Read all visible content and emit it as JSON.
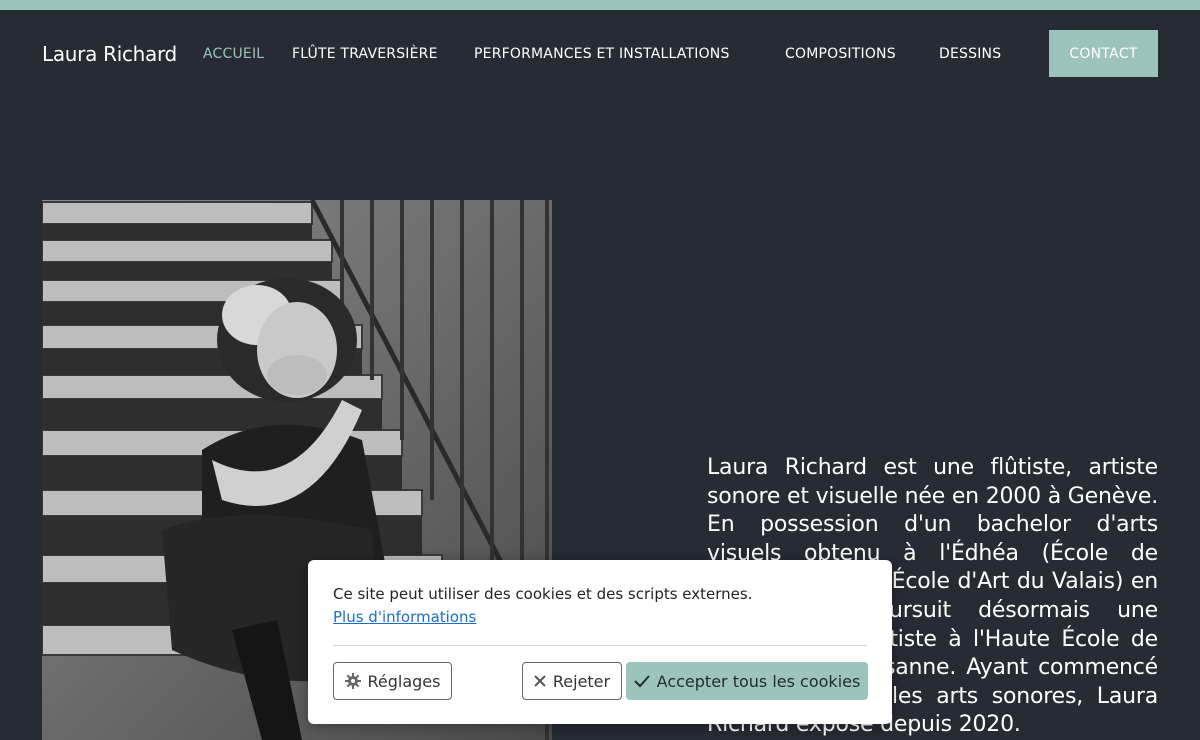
{
  "header": {
    "brand": "Laura Richard",
    "nav": [
      {
        "label": "ACCUEIL",
        "active": true
      },
      {
        "label": "FLÛTE TRAVERSIÈRE",
        "active": false
      },
      {
        "label": "PERFORMANCES ET INSTALLATIONS",
        "active": false
      },
      {
        "label": "COMPOSITIONS",
        "active": false
      },
      {
        "label": "DESSINS",
        "active": false
      }
    ],
    "contact_label": "CONTACT"
  },
  "hero": {
    "bio": "Laura Richard est une flûtiste, artiste sonore et visuelle née en 2000 à Genève. En possession d'un bachelor d'arts visuels obtenu à l'Édhéa (École de Design et Haute École d'Art du Valais) en 2022, elle poursuit désormais une formation de flûtiste à l'Haute École de Musique de Lausanne. Ayant commencé à travailler sur les arts sonores, Laura Richard expose depuis 2020."
  },
  "cookie_banner": {
    "message": "Ce site peut utiliser des cookies et des scripts externes.",
    "more_link": "Plus d'informations",
    "settings_label": "Réglages",
    "reject_label": "Rejeter",
    "accept_label": "Accepter tous les cookies",
    "settings_icon": "gear-icon",
    "reject_icon": "close-icon",
    "accept_icon": "check-icon"
  },
  "colors": {
    "background": "#272b33",
    "accent": "#9cc4bd",
    "text": "#ffffff"
  }
}
